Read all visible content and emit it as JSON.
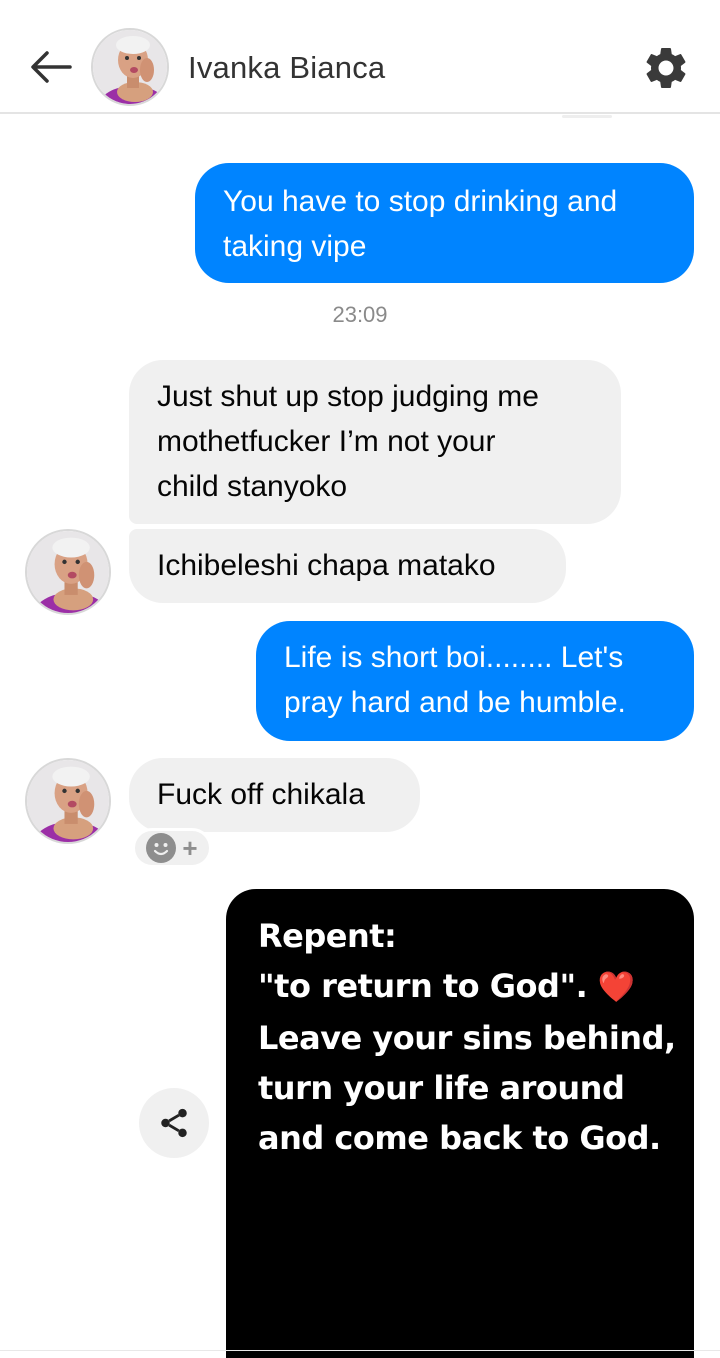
{
  "header": {
    "contact_name": "Ivanka Bianca",
    "back_icon": "arrow-left-icon",
    "settings_icon": "gear-icon"
  },
  "messages": [
    {
      "direction": "outgoing",
      "text_lines": [
        "You have to stop drinking and",
        "taking vipe"
      ]
    },
    {
      "direction": "incoming",
      "text_lines": [
        "Just shut up stop judging me",
        "mothetfucker I’m not your",
        "child stanyoko"
      ]
    },
    {
      "direction": "incoming",
      "text_lines": [
        "Ichibeleshi chapa matako"
      ]
    },
    {
      "direction": "outgoing",
      "text_lines": [
        "Life is short boi........ Let's",
        "pray hard and be humble."
      ]
    },
    {
      "direction": "incoming",
      "text_lines": [
        "Fuck off chikala"
      ]
    }
  ],
  "timestamp": "23:09",
  "reaction": {
    "icon": "smiley-add-reaction-icon",
    "plus": "+"
  },
  "share": {
    "icon": "share-icon"
  },
  "image_message": {
    "lines": [
      "Repent:",
      "\"to return to God\".",
      "Leave your sins behind,",
      "turn your life around",
      "and come back to God."
    ],
    "emoji": "❤️"
  },
  "colors": {
    "outgoing_bubble": "#0084ff",
    "incoming_bubble": "#f0f0f0",
    "image_background": "#000000"
  }
}
